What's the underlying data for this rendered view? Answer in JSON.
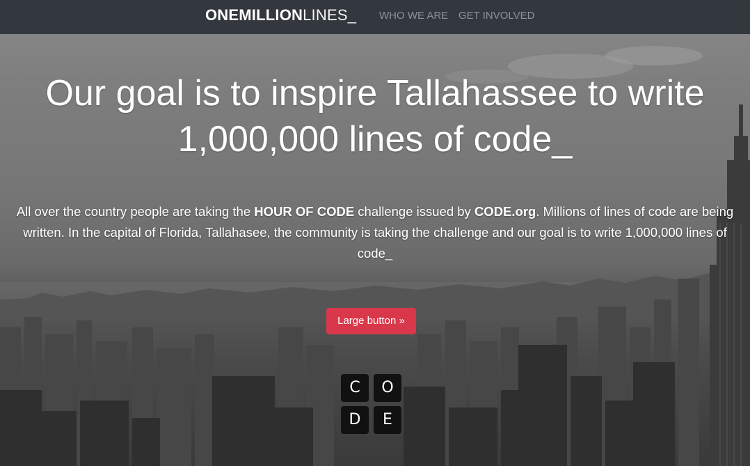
{
  "navbar": {
    "brand_bold": "ONEMILLION",
    "brand_light": "LINES_",
    "links": [
      "WHO WE ARE",
      "GET INVOLVED"
    ]
  },
  "hero": {
    "headline_line1": "Our goal is to inspire Tallahassee to write",
    "headline_line2": "1,000,000 lines of code_",
    "lead": {
      "part1": "All over the country people are taking the ",
      "bold1": "HOUR OF CODE",
      "part2": " challenge issued by ",
      "bold2": "CODE.org",
      "part3": ". Millions of lines of code are being written. In the capital of Florida, Tallahasee, the community is taking the challenge and our goal is to write 1,000,000 lines of code_"
    },
    "button_label": "Large button »",
    "code_logo_letters": [
      "C",
      "O",
      "D",
      "E"
    ]
  },
  "colors": {
    "navbar_bg": "#33373e",
    "nav_link": "#8e939a",
    "button_bg": "#d9384a",
    "logo_tile": "#111111"
  },
  "icons": {
    "code_logo": "code-org-logo"
  }
}
